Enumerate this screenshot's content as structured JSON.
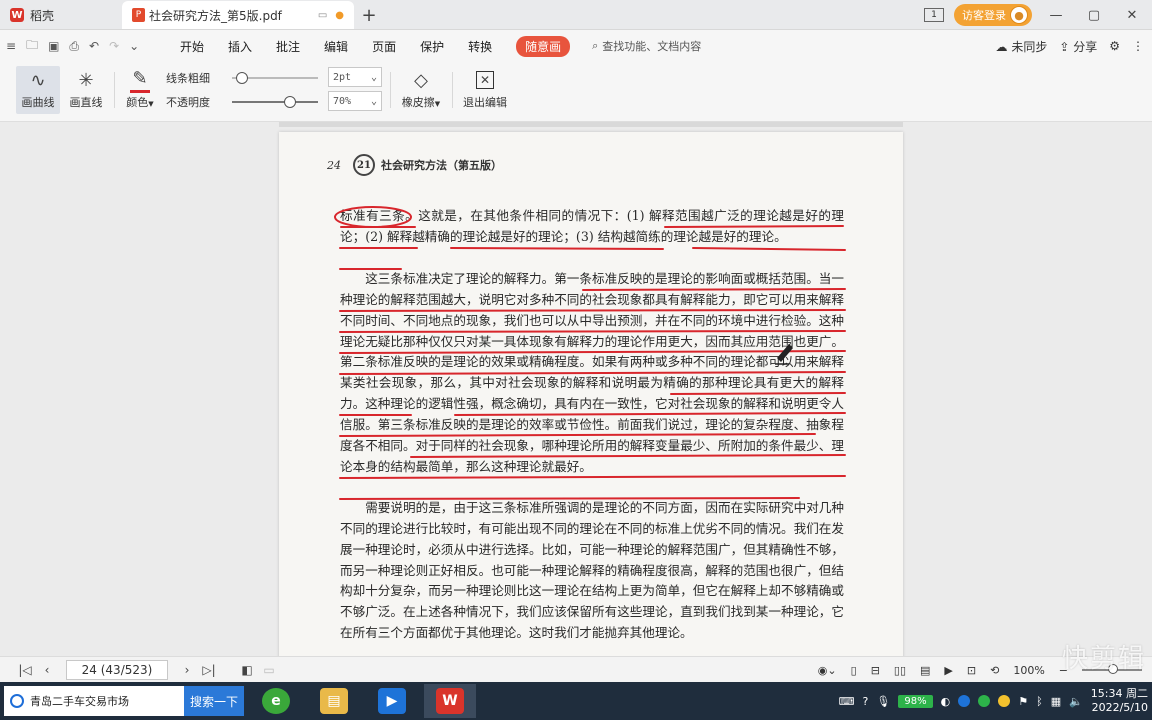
{
  "tabs": {
    "home_label": "稻壳",
    "doc_label": "社会研究方法_第5版.pdf",
    "new_tab": "+"
  },
  "window": {
    "badge": "1",
    "login_label": "访客登录",
    "minimize": "—",
    "restore": "▢",
    "close": "✕"
  },
  "menu": {
    "items": [
      "开始",
      "插入",
      "批注",
      "编辑",
      "页面",
      "保护",
      "转换"
    ],
    "active": "随意画",
    "search_placeholder": "查找功能、文档内容",
    "sync_label": "未同步",
    "share_label": "分享"
  },
  "ink_toolbar": {
    "curve_label": "画曲线",
    "line_label": "画直线",
    "color_label": "颜色",
    "thickness_label": "线条粗细",
    "opacity_label": "不透明度",
    "thickness_value": "2pt",
    "opacity_value": "70%",
    "eraser_label": "橡皮擦",
    "exit_label": "退出编辑",
    "ink_color": "#d8262c",
    "thickness_level": 0.05,
    "opacity_level": 0.7
  },
  "document": {
    "page_number": "24",
    "book_title": "社会研究方法（第五版）",
    "emblem_text": "21",
    "paragraphs": [
      "标准有三条。这就是，在其他条件相同的情况下：(1) 解释范围越广泛的理论越是好的理论；(2) 解释越精确的理论越是好的理论；(3) 结构越简练的理论越是好的理论。",
      "这三条标准决定了理论的解释力。第一条标准反映的是理论的影响面或概括范围。当一种理论的解释范围越大，说明它对多种不同的社会现象都具有解释能力，即它可以用来解释不同时间、不同地点的现象，我们也可以从中导出预测，并在不同的环境中进行检验。这种理论无疑比那种仅仅只对某一具体现象有解释力的理论作用更大，因而其应用范围也更广。第二条标准反映的是理论的效果或精确程度。如果有两种或多种不同的理论都可以用来解释某类社会现象，那么，其中对社会现象的解释和说明最为精确的那种理论具有更大的解释力。这种理论的逻辑性强，概念确切，具有内在一致性，它对社会现象的解释和说明更令人信服。第三条标准反映的是理论的效率或节俭性。前面我们说过，理论的复杂程度、抽象程度各不相同。对于同样的社会现象，哪种理论所用的解释变量最少、所附加的条件最少、理论本身的结构最简单，那么这种理论就最好。",
      "需要说明的是，由于这三条标准所强调的是理论的不同方面，因而在实际研究中对几种不同的理论进行比较时，有可能出现不同的理论在不同的标准上优劣不同的情况。我们在发展一种理论时，必须从中进行选择。比如，可能一种理论的解释范围广，但其精确性不够，而另一种理论则正好相反。也可能一种理论解释的精确程度很高，解释的范围也很广，但结构却十分复杂，而另一种理论则比这一理论在结构上更为简单，但它在解释上却不够精确或不够广泛。在上述各种情况下，我们应该保留所有这些理论，直到我们找到某一种理论，它在所有三个方面都优于其他理论。这时我们才能抛弃其他理论。"
    ]
  },
  "status": {
    "page_display": "24 (43/523)",
    "zoom": "100%"
  },
  "watermark": "快剪辑",
  "taskbar": {
    "search_text": "青岛二手车交易市场",
    "search_button": "搜索一下",
    "battery": "98%",
    "time": "15:34 周二",
    "date": "2022/5/10"
  },
  "colors": {
    "accent": "#e8543d",
    "ink": "#d8262c",
    "login": "#f3a233",
    "taskbar": "#1f2d3d"
  }
}
